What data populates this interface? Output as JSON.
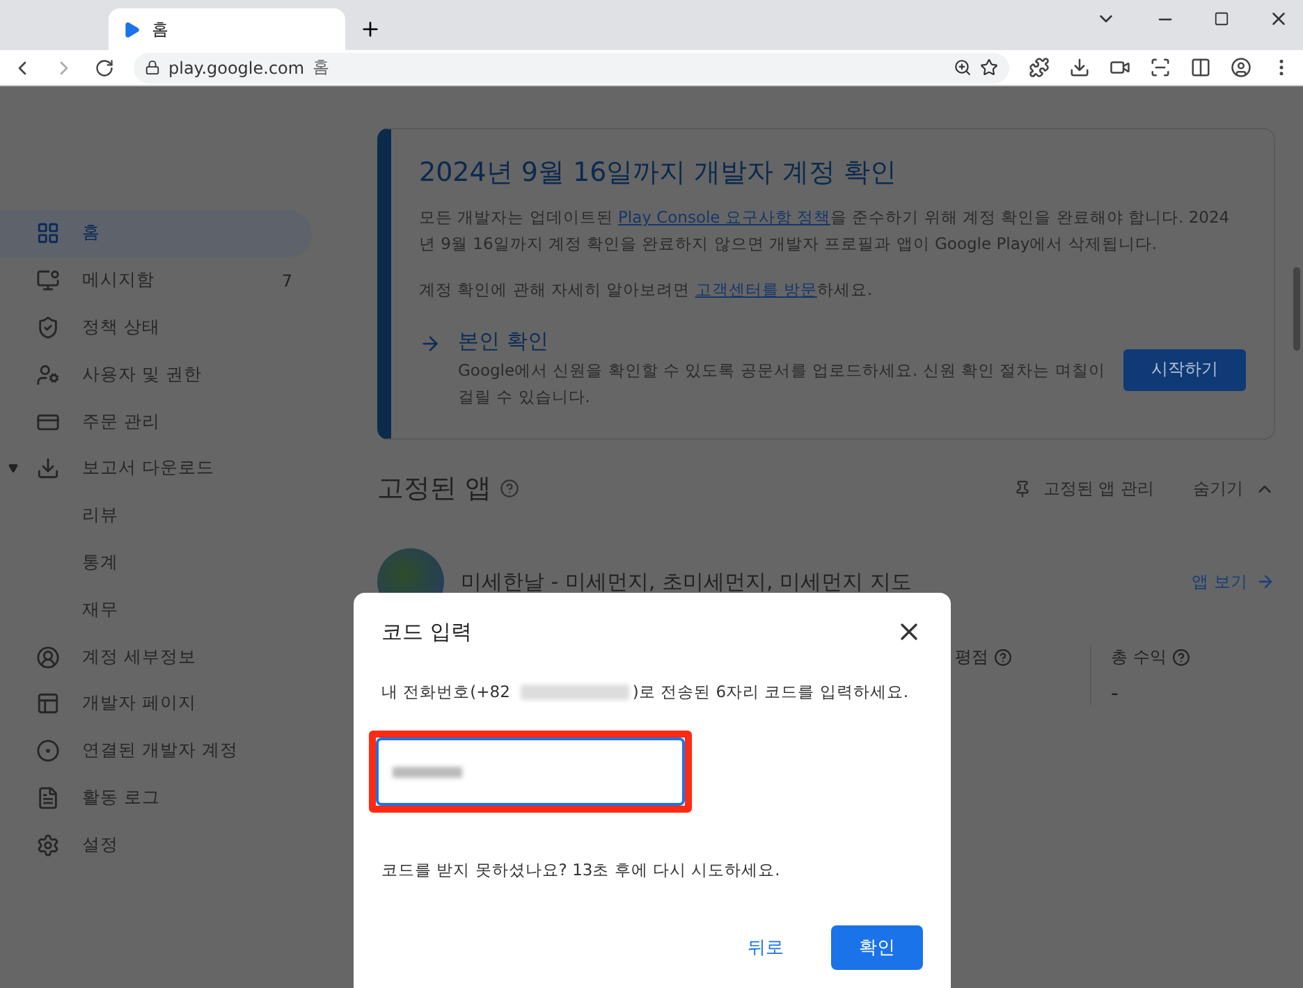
{
  "browser": {
    "tab_title": "홈",
    "url_host": "play.google.com",
    "url_page": "홈"
  },
  "sidebar": {
    "items": [
      {
        "label": "홈",
        "selected": true
      },
      {
        "label": "메시지함",
        "badge": "7",
        "selected": false
      },
      {
        "label": "정책 상태",
        "selected": false
      },
      {
        "label": "사용자 및 권한",
        "selected": false
      },
      {
        "label": "주문 관리",
        "selected": false
      },
      {
        "label": "보고서 다운로드",
        "selected": false,
        "expanded": true,
        "children": [
          {
            "label": "리뷰",
            "selected": false
          },
          {
            "label": "통계",
            "selected": false
          },
          {
            "label": "재무",
            "selected": false
          }
        ]
      },
      {
        "label": "계정 세부정보",
        "selected": false
      },
      {
        "label": "개발자 페이지",
        "selected": false
      },
      {
        "label": "연결된 개발자 계정",
        "selected": false
      },
      {
        "label": "활동 로그",
        "selected": false
      },
      {
        "label": "설정",
        "selected": false
      }
    ]
  },
  "banner": {
    "title": "2024년 9월 16일까지 개발자 계정 확인",
    "body_before": "모든 개발자는 업데이트된 ",
    "body_link": "Play Console 요구사항 정책",
    "body_after": "을 준수하기 위해 계정 확인을 완료해야 합니다. 2024년 9월 16일까지 계정 확인을 완료하지 않으면 개발자 프로필과 앱이 Google Play에서 삭제됩니다.",
    "help_before": "계정 확인에 관해 자세히 알아보려면 ",
    "help_link": "고객센터를 방문",
    "help_after": "하세요.",
    "step": {
      "title": "본인 확인",
      "description": "Google에서 신원을 확인할 수 있도록 공문서를 업로드하세요. 신원 확인 절차는 며칠이 걸릴 수 있습니다.",
      "button": "시작하기"
    }
  },
  "pinned": {
    "title": "고정된 앱",
    "manage": "고정된 앱 관리",
    "hide": "숨기기",
    "app": {
      "name": "미세한날 - 미세먼지, 초미세먼지, 미세먼지 지도",
      "view": "앱 보기"
    },
    "stats": [
      {
        "label": "평점"
      },
      {
        "label": "총 수익",
        "value": "-"
      }
    ]
  },
  "dialog": {
    "title": "코드 입력",
    "message_before": "내 전화번호(+82",
    "message_after": ")로 전송된 6자리 코드를 입력하세요.",
    "resend": "코드를 받지 못하셨나요? 13초 후에 다시 시도하세요.",
    "buttons": [
      {
        "label": "뒤로",
        "kind": "text"
      },
      {
        "label": "확인",
        "kind": "filled"
      }
    ]
  }
}
